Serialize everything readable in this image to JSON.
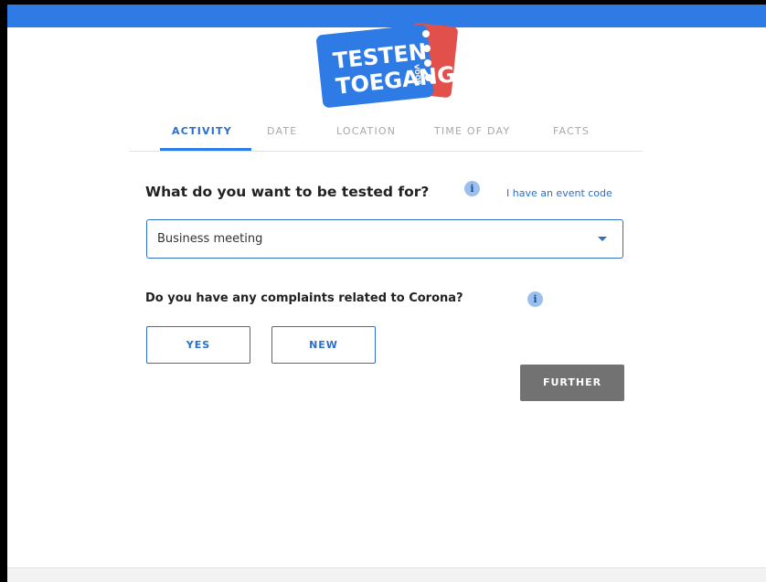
{
  "logo": {
    "line1": "TESTEN",
    "small": "VOOR",
    "line2": "TOEGANG",
    "colors": {
      "blue": "#2f7be5",
      "red": "#e2504c"
    }
  },
  "tabs": [
    {
      "label": "ACTIVITY",
      "active": true
    },
    {
      "label": "DATE",
      "active": false
    },
    {
      "label": "LOCATION",
      "active": false
    },
    {
      "label": "TIME OF DAY",
      "active": false
    },
    {
      "label": "FACTS",
      "active": false
    }
  ],
  "form": {
    "question": "What do you want to be tested for?",
    "event_code_link": "I have an event code",
    "activity_select": {
      "value": "Business meeting"
    },
    "complaints_question": "Do you have any complaints related to Corona?",
    "yes_label": "YES",
    "no_label": "NEW",
    "further_label": "FURTHER"
  },
  "icons": {
    "info": "info-icon",
    "dropdown": "chevron-down-icon"
  },
  "colors": {
    "accent": "#2f7be5",
    "link": "#2b6fca",
    "disabled_button": "#727272"
  }
}
